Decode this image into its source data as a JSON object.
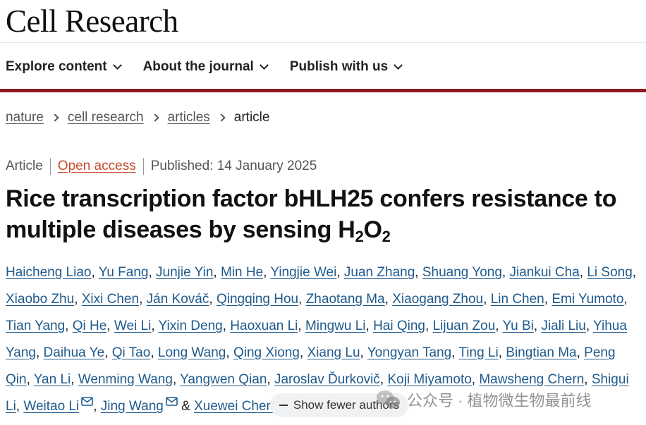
{
  "header": {
    "logo": "Cell Research",
    "nav": [
      {
        "label": "Explore content"
      },
      {
        "label": "About the journal"
      },
      {
        "label": "Publish with us"
      }
    ]
  },
  "colors": {
    "brand_bar": "#8b1a1f",
    "open_access": "#c8472b",
    "author_link": "#1f5a8c"
  },
  "breadcrumb": {
    "items": [
      "nature",
      "cell research",
      "articles"
    ],
    "current": "article"
  },
  "meta": {
    "type": "Article",
    "access": "Open access",
    "published": "Published: 14 January 2025"
  },
  "article": {
    "title_main": "Rice transcription factor bHLH25 confers resistance to multiple diseases by sensing H",
    "title_sub1": "2",
    "title_mid": "O",
    "title_sub2": "2"
  },
  "authors": [
    "Haicheng Liao",
    "Yu Fang",
    "Junjie Yin",
    "Min He",
    "Yingjie Wei",
    "Juan Zhang",
    "Shuang Yong",
    "Jiankui Cha",
    "Li Song",
    "Xiaobo Zhu",
    "Xixi Chen",
    "Ján Kováč",
    "Qingqing Hou",
    "Zhaotang Ma",
    "Xiaogang Zhou",
    "Lin Chen",
    "Emi Yumoto",
    "Tian Yang",
    "Qi He",
    "Wei Li",
    "Yixin Deng",
    "Haoxuan Li",
    "Mingwu Li",
    "Hai Qing",
    "Lijuan Zou",
    "Yu Bi",
    "Jiali Liu",
    "Yihua Yang",
    "Daihua Ye",
    "Qi Tao",
    "Long Wang",
    "Qing Xiong",
    "Xiang Lu",
    "Yongyan Tang",
    "Ting Li",
    "Bingtian Ma",
    "Peng Qin",
    "Yan Li",
    "Wenming Wang",
    "Yangwen Qian",
    "Jaroslav Ďurkovič",
    "Koji Miyamoto",
    "Mawsheng Chern",
    "Shigui Li"
  ],
  "corresponding_authors": [
    "Weitao Li",
    "Jing Wang",
    "Xuewei Chen"
  ],
  "authors_and": "&",
  "show_fewer_label": "Show fewer authors",
  "watermark": {
    "text": "公众号 · 植物微生物最前线",
    "icon": "wechat-icon"
  },
  "icons": {
    "nav_chevron": "chevron-down-icon",
    "breadcrumb_sep": "chevron-right-icon",
    "email": "envelope-icon",
    "collapse": "minus-icon"
  }
}
